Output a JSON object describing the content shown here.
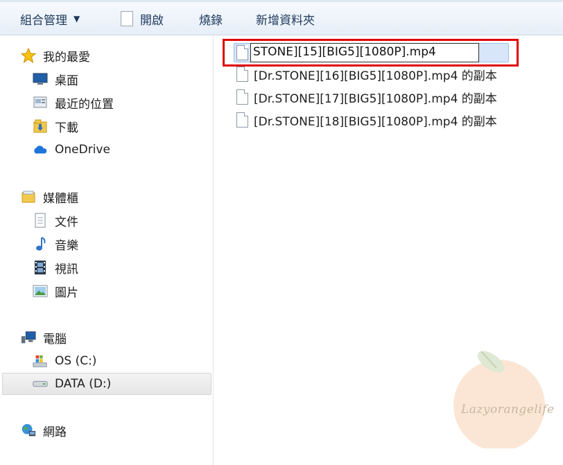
{
  "toolbar": {
    "organize_label": "組合管理",
    "open_label": "開啟",
    "burn_label": "燒錄",
    "new_folder_label": "新增資料夾"
  },
  "nav": {
    "favorites": {
      "header": "我的最愛",
      "items": [
        {
          "label": "桌面",
          "icon": "desktop-icon"
        },
        {
          "label": "最近的位置",
          "icon": "recent-places-icon"
        },
        {
          "label": "下載",
          "icon": "downloads-folder-icon"
        },
        {
          "label": "OneDrive",
          "icon": "onedrive-cloud-icon"
        }
      ]
    },
    "libraries": {
      "header": "媒體櫃",
      "items": [
        {
          "label": "文件",
          "icon": "documents-icon"
        },
        {
          "label": "音樂",
          "icon": "music-note-icon"
        },
        {
          "label": "視訊",
          "icon": "video-film-icon"
        },
        {
          "label": "圖片",
          "icon": "pictures-icon"
        }
      ]
    },
    "computer": {
      "header": "電腦",
      "items": [
        {
          "label": "OS (C:)",
          "icon": "windows-drive-icon"
        },
        {
          "label": "DATA (D:)",
          "icon": "hard-drive-icon",
          "selected": true
        }
      ]
    },
    "network": {
      "header": "網路"
    }
  },
  "files": {
    "rename_value": "STONE][15][BIG5][1080P].mp4",
    "items": [
      {
        "name": "[Dr.STONE][16][BIG5][1080P].mp4 的副本"
      },
      {
        "name": "[Dr.STONE][17][BIG5][1080P].mp4 的副本"
      },
      {
        "name": "[Dr.STONE][18][BIG5][1080P].mp4 的副本"
      }
    ]
  },
  "watermark": {
    "text": "Lazyorangelife"
  },
  "colors": {
    "highlight_box": "#e00000",
    "selection_fill": "#d8e6fa",
    "toolbar_text": "#1e395b"
  }
}
